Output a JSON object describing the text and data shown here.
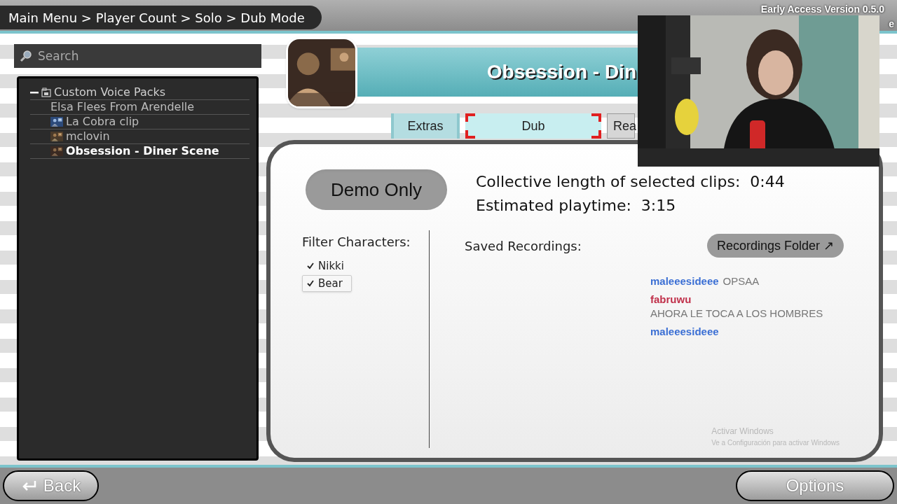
{
  "breadcrumb": "Main Menu > Player Count > Solo > Dub Mode",
  "version": "Early Access Version 0.5.0",
  "version_cut": "e",
  "search": {
    "placeholder": "Search"
  },
  "tree": [
    {
      "label": "Custom Voice Packs",
      "expanded": true,
      "children": [
        {
          "label": "Elsa Flees From Arendelle",
          "kind": "plain",
          "selected": false
        },
        {
          "label": "La Cobra clip",
          "kind": "thumbnail",
          "selected": false
        },
        {
          "label": "mclovin",
          "kind": "thumbnail",
          "selected": false
        },
        {
          "label": "Obsession - Diner Scene",
          "kind": "thumbnail",
          "selected": true
        }
      ]
    }
  ],
  "clip": {
    "title": "Obsession - Din"
  },
  "tabs": [
    {
      "label": "Extras",
      "selected": false
    },
    {
      "label": "Dub",
      "selected": true
    },
    {
      "label": "Rea",
      "selected": false
    }
  ],
  "demo_button": "Demo Only",
  "filter": {
    "label": "Filter Characters:",
    "characters": [
      {
        "name": "Nikki",
        "checked": true,
        "selected": false
      },
      {
        "name": "Bear",
        "checked": true,
        "selected": true
      }
    ]
  },
  "stats": [
    {
      "label": "Collective length of selected clips:",
      "value": "0:44"
    },
    {
      "label": "Estimated playtime:",
      "value": "3:15"
    }
  ],
  "saved_recordings": "Saved Recordings:",
  "folder_button": "Recordings Folder ↗",
  "chat": [
    {
      "user": "maleeesideee",
      "color": "#3b6fd4",
      "message": "OPSAA"
    },
    {
      "user": "fabruwu",
      "color": "#c0304a",
      "message": "AHORA LE TOCA A LOS HOMBRES"
    },
    {
      "user": "maleeesideee",
      "color": "#3b6fd4"
    }
  ],
  "os_notice": [
    "Activar Windows",
    "Ve a Configuración para activar Windows"
  ],
  "footer": {
    "back": "Back",
    "options": "Options"
  }
}
